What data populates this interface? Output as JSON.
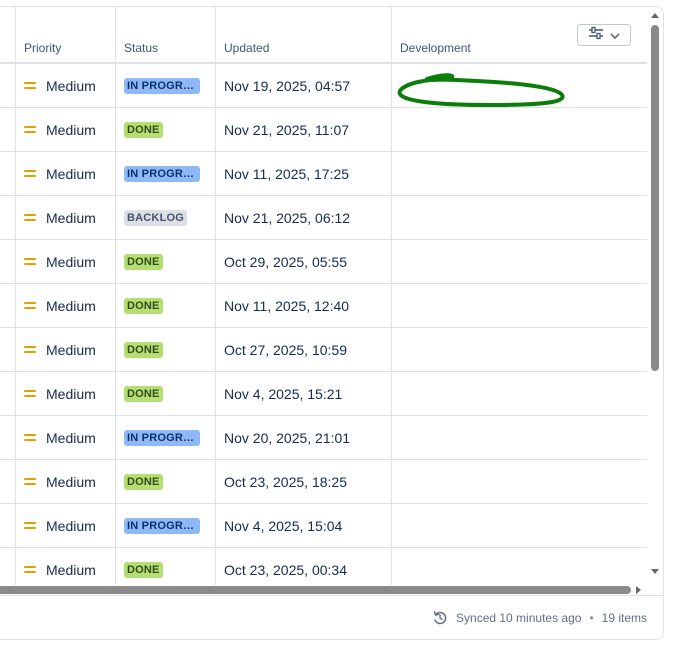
{
  "columns": {
    "priority": "Priority",
    "status": "Status",
    "updated": "Updated",
    "development": "Development"
  },
  "rows": [
    {
      "priority": "Medium",
      "status": "IN PROGRE…",
      "status_kind": "inprogress",
      "updated": "Nov 19, 2025, 04:57"
    },
    {
      "priority": "Medium",
      "status": "DONE",
      "status_kind": "done",
      "updated": "Nov 21, 2025, 11:07"
    },
    {
      "priority": "Medium",
      "status": "IN PROGRE…",
      "status_kind": "inprogress",
      "updated": "Nov 11, 2025, 17:25"
    },
    {
      "priority": "Medium",
      "status": "BACKLOG",
      "status_kind": "backlog",
      "updated": "Nov 21, 2025, 06:12"
    },
    {
      "priority": "Medium",
      "status": "DONE",
      "status_kind": "done",
      "updated": "Oct 29, 2025, 05:55"
    },
    {
      "priority": "Medium",
      "status": "DONE",
      "status_kind": "done",
      "updated": "Nov 11, 2025, 12:40"
    },
    {
      "priority": "Medium",
      "status": "DONE",
      "status_kind": "done",
      "updated": "Oct 27, 2025, 10:59"
    },
    {
      "priority": "Medium",
      "status": "DONE",
      "status_kind": "done",
      "updated": "Nov 4, 2025, 15:21"
    },
    {
      "priority": "Medium",
      "status": "IN PROGRE…",
      "status_kind": "inprogress",
      "updated": "Nov 20, 2025, 21:01"
    },
    {
      "priority": "Medium",
      "status": "DONE",
      "status_kind": "done",
      "updated": "Oct 23, 2025, 18:25"
    },
    {
      "priority": "Medium",
      "status": "IN PROGRE…",
      "status_kind": "inprogress",
      "updated": "Nov 4, 2025, 15:04"
    },
    {
      "priority": "Medium",
      "status": "DONE",
      "status_kind": "done",
      "updated": "Oct 23, 2025, 00:34"
    }
  ],
  "footer": {
    "synced": "Synced 10 minutes ago",
    "separator": "•",
    "count": "19 items"
  },
  "icons": {
    "priority": "priority-medium-icon",
    "view_settings": "sliders-icon",
    "dropdown": "chevron-down-icon",
    "sync": "sync-icon"
  },
  "colors": {
    "priority_medium": "#e2a000",
    "in_progress_bg": "#8fb8f6",
    "done_bg": "#b3df72",
    "backlog_bg": "#dcdfe4",
    "annotation": "#0b7d0b"
  }
}
